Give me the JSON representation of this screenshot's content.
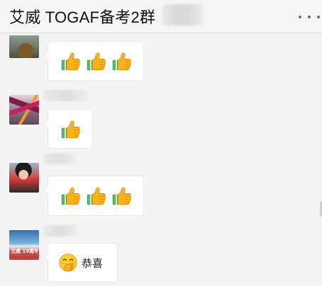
{
  "header": {
    "title": "艾威 TOGAF备考2群",
    "more_icon": "more-horizontal-icon"
  },
  "messages": [
    {
      "avatar": "avatar-landscape",
      "content": {
        "emoji": "thumbs-up-icon",
        "count": 3
      }
    },
    {
      "avatar": "avatar-colorful-figures",
      "content": {
        "emoji": "thumbs-up-icon",
        "count": 1
      }
    },
    {
      "avatar": "avatar-child-red-scarf",
      "content": {
        "emoji": "thumbs-up-icon",
        "count": 3
      }
    },
    {
      "avatar": "avatar-blue-sky",
      "avatar_text": "艾威 19周年庆",
      "content": {
        "emoji": "hand-over-mouth-icon",
        "text": "恭喜"
      }
    }
  ],
  "colors": {
    "background": "#f4f4f4",
    "bubble": "#ffffff",
    "thumb_yellow": "#f6b21a",
    "thumb_sleeve": "#2ea84a"
  }
}
